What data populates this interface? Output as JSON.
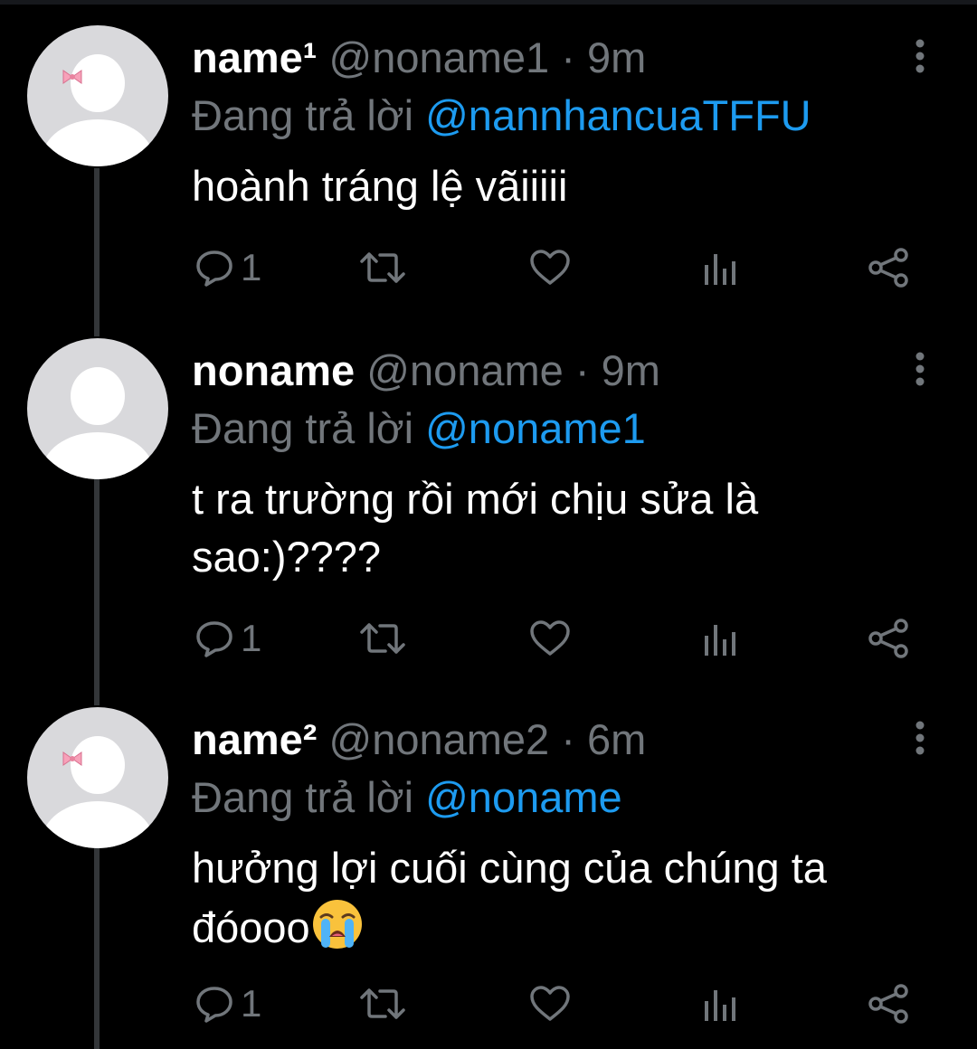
{
  "colors": {
    "background": "#000000",
    "text_primary": "#ffffff",
    "text_secondary": "#71767b",
    "mention_blue": "#1d9bf0",
    "thread_line": "#333639",
    "avatar_bg": "#d9d9dc",
    "bow_pink": "#f7a1b9"
  },
  "tweets": [
    {
      "display_name": "name¹",
      "handle": "@noname1",
      "separator": "·",
      "time": "9m",
      "reply_prefix": "Đang trả lời",
      "reply_to": "@nannhancuaTFFU",
      "text": "hoành tráng lệ vãiiiii",
      "reply_count": "1",
      "avatar_has_bow": true,
      "icons": [
        "reply-icon",
        "retweet-icon",
        "like-icon",
        "analytics-icon",
        "share-icon",
        "more-icon"
      ]
    },
    {
      "display_name": "noname",
      "handle": "@noname",
      "separator": "·",
      "time": "9m",
      "reply_prefix": "Đang trả lời",
      "reply_to": "@noname1",
      "text": "t ra trường rồi mới chịu sửa là sao:)????",
      "reply_count": "1",
      "avatar_has_bow": false,
      "icons": [
        "reply-icon",
        "retweet-icon",
        "like-icon",
        "analytics-icon",
        "share-icon",
        "more-icon"
      ]
    },
    {
      "display_name": "name²",
      "handle": "@noname2",
      "separator": "·",
      "time": "6m",
      "reply_prefix": "Đang trả lời",
      "reply_to": "@noname",
      "text": "hưởng lợi cuối cùng của chúng ta đóooo",
      "text_emoji": "loudly-crying-face-emoji",
      "reply_count": "1",
      "avatar_has_bow": true,
      "icons": [
        "reply-icon",
        "retweet-icon",
        "like-icon",
        "analytics-icon",
        "share-icon",
        "more-icon"
      ]
    }
  ]
}
